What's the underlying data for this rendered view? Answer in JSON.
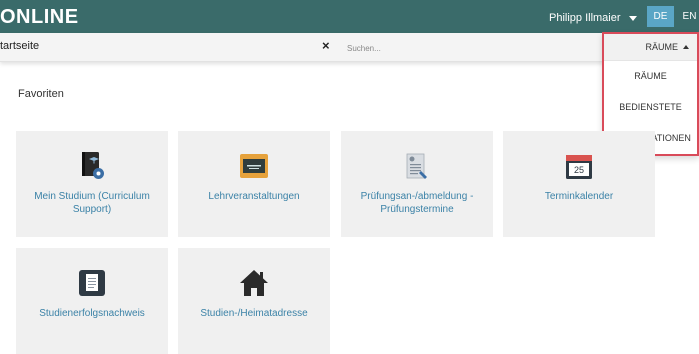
{
  "header": {
    "brand": "ONLINE",
    "user": "Philipp Illmaier",
    "lang_de": "DE",
    "lang_en": "EN"
  },
  "subbar": {
    "breadcrumb": "tartseite",
    "clear": "×",
    "search_placeholder": "Suchen..."
  },
  "dropdown": {
    "selected": "RÄUME",
    "items": [
      "RÄUME",
      "BEDIENSTETE",
      "ORGANISATIONEN"
    ]
  },
  "main": {
    "section_title": "Favoriten",
    "tiles": [
      {
        "label": "Mein Studium (Curriculum Support)",
        "icon": "book-gear-icon"
      },
      {
        "label": "Lehrveranstaltungen",
        "icon": "chalkboard-icon"
      },
      {
        "label": "Prüfungsan-/abmeldung - Prüfungstermine",
        "icon": "exam-document-icon"
      },
      {
        "label": "Terminkalender",
        "icon": "calendar-icon",
        "icon_text": "25"
      },
      {
        "label": "Studienerfolgsnachweis",
        "icon": "transcript-document-icon"
      },
      {
        "label": "Studien-/Heimatadresse",
        "icon": "house-icon"
      }
    ]
  },
  "colors": {
    "topbar": "#3a6b6a",
    "lang_active": "#5aa6c6",
    "tile_bg": "#f0f0f0",
    "tile_text": "#3b82a7",
    "highlight": "#d94b5a"
  }
}
